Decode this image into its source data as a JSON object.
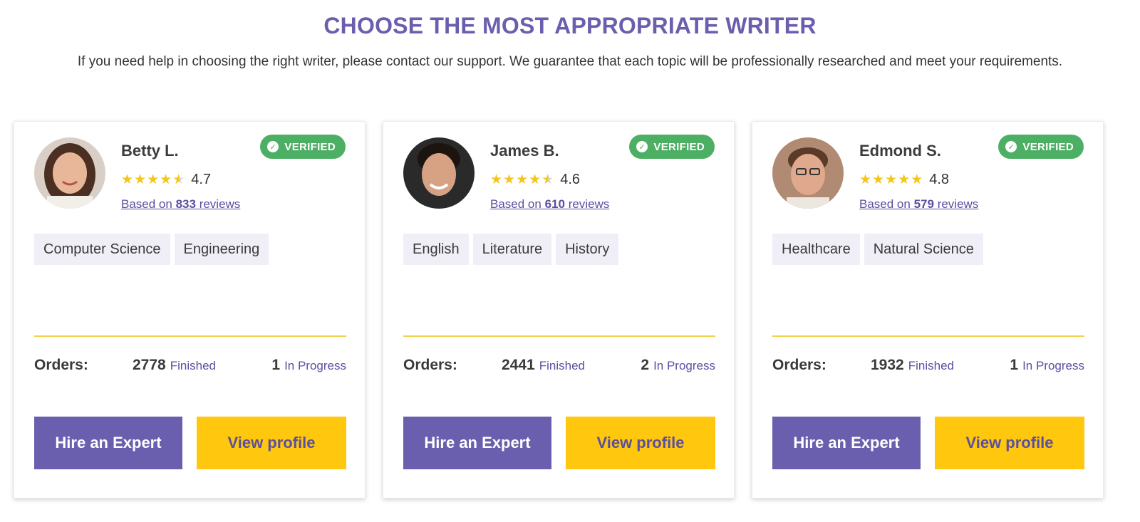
{
  "page": {
    "title": "CHOOSE THE MOST APPROPRIATE WRITER",
    "subtitle": "If you need help in choosing the right writer, please contact our support. We guarantee that each topic will be professionally researched and meet your requirements."
  },
  "labels": {
    "verified": "VERIFIED",
    "based_on": "Based on",
    "reviews": "reviews",
    "orders": "Orders:",
    "finished": "Finished",
    "in_progress": "In Progress",
    "hire": "Hire an Expert",
    "view_profile": "View profile"
  },
  "colors": {
    "accent": "#6a5fae",
    "yellow": "#ffc70e",
    "verified_green": "#4caf64",
    "star": "#f5c518"
  },
  "writers": [
    {
      "name": "Betty L.",
      "rating": "4.7",
      "rating_value": 4.7,
      "reviews_count": "833",
      "tags": [
        "Computer Science",
        "Engineering"
      ],
      "finished": "2778",
      "in_progress": "1"
    },
    {
      "name": "James B.",
      "rating": "4.6",
      "rating_value": 4.6,
      "reviews_count": "610",
      "tags": [
        "English",
        "Literature",
        "History"
      ],
      "finished": "2441",
      "in_progress": "2"
    },
    {
      "name": "Edmond S.",
      "rating": "4.8",
      "rating_value": 4.8,
      "reviews_count": "579",
      "tags": [
        "Healthcare",
        "Natural Science"
      ],
      "finished": "1932",
      "in_progress": "1"
    }
  ]
}
